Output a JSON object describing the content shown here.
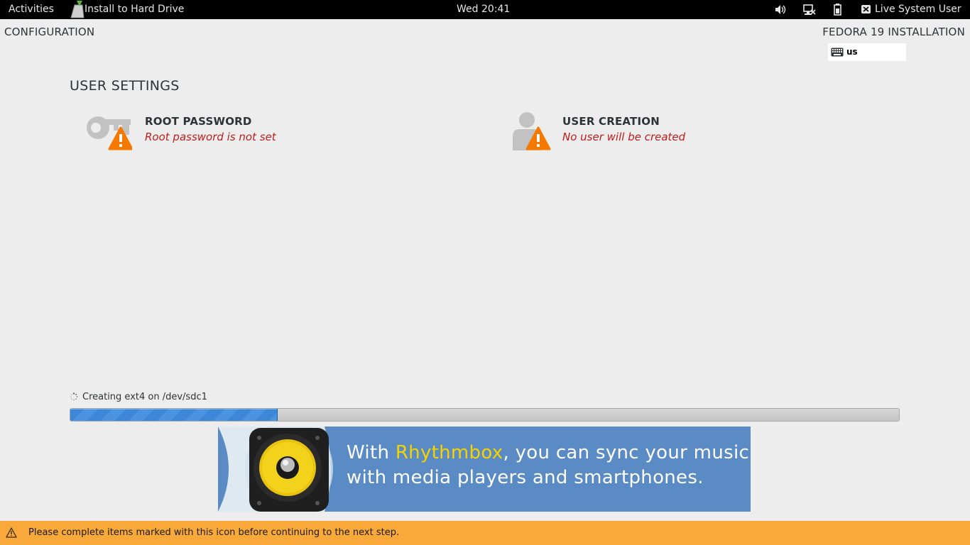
{
  "topbar": {
    "activities": "Activities",
    "app_name": "Install to Hard Drive",
    "clock": "Wed 20:41",
    "user": "Live System User",
    "icons": [
      "volume-icon",
      "network-icon",
      "battery-icon",
      "user-icon"
    ]
  },
  "header": {
    "title": "CONFIGURATION",
    "product": "FEDORA 19 INSTALLATION",
    "keyboard_layout": "us"
  },
  "section": {
    "title": "USER SETTINGS",
    "spokes": [
      {
        "title": "ROOT PASSWORD",
        "status": "Root password is not set",
        "icon": "key-icon"
      },
      {
        "title": "USER CREATION",
        "status": "No user will be created",
        "icon": "person-icon"
      }
    ]
  },
  "progress": {
    "label": "Creating ext4 on /dev/sdc1",
    "fraction": 0.25
  },
  "banner": {
    "line1_before": "With ",
    "line1_highlight": "Rhythmbox",
    "line1_after": ", you can sync your music",
    "line2": "with media players and smartphones."
  },
  "warning": {
    "text": "Please complete items marked with this icon before continuing to the next step."
  },
  "colors": {
    "warning_bar": "#f8a93a",
    "status_error": "#c01c1c",
    "progress_fill": "#3d87d8",
    "banner_bg": "#5b8bc4",
    "banner_highlight": "#f5d300"
  }
}
